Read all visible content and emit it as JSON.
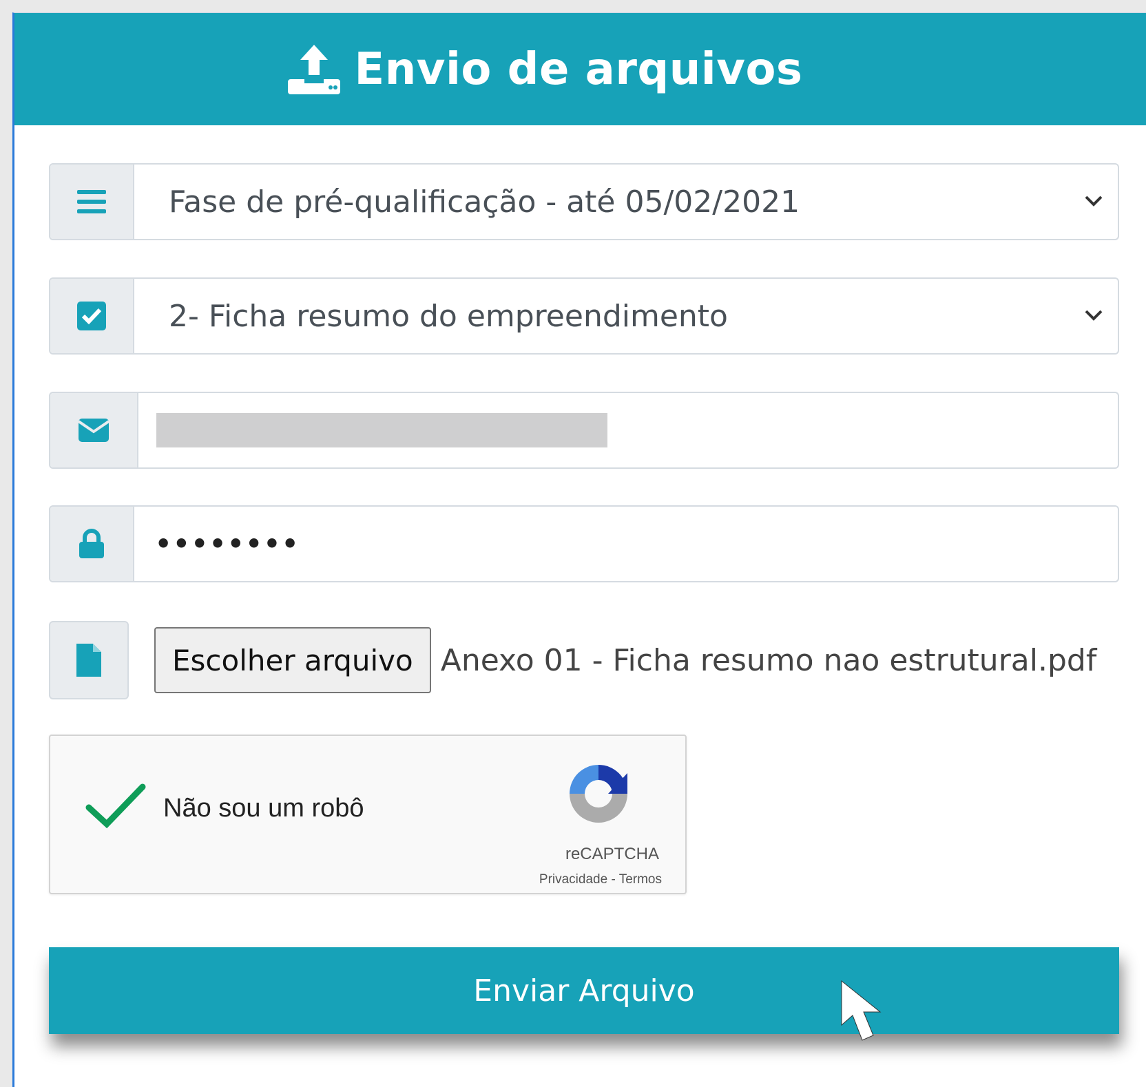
{
  "header": {
    "title": "Envio de arquivos",
    "icon": "upload-icon"
  },
  "form": {
    "phase_select": {
      "value": "Fase de pré-qualificação - até 05/02/2021",
      "icon": "list-icon"
    },
    "document_select": {
      "value": "2- Ficha resumo do empreendimento",
      "icon": "checkbox-icon"
    },
    "email_field": {
      "icon": "envelope-icon"
    },
    "password_field": {
      "value": "••••••••",
      "icon": "lock-icon"
    },
    "file_input": {
      "button_label": "Escolher arquivo",
      "file_name": "Anexo 01 - Ficha resumo nao estrutural.pdf",
      "icon": "file-icon"
    },
    "captcha": {
      "label": "Não sou um robô",
      "brand": "reCAPTCHA",
      "links": "Privacidade - Termos",
      "checked": true
    },
    "submit_label": "Enviar Arquivo"
  },
  "colors": {
    "accent": "#17a2b8",
    "check": "#0f9d58"
  }
}
